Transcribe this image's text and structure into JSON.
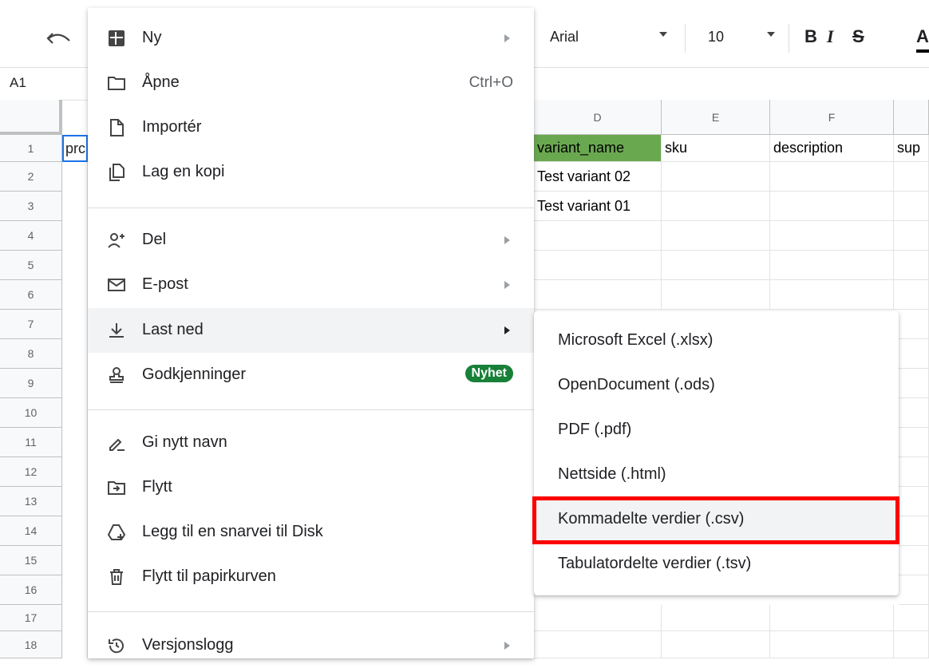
{
  "toolbar": {
    "font_name": "Arial",
    "font_size": "10",
    "bold_label": "B",
    "italic_label": "I",
    "strike_label": "S",
    "text_color_label": "A"
  },
  "formula_bar": {
    "name_box": "A1"
  },
  "grid": {
    "columns": [
      "D",
      "E",
      "F"
    ],
    "rows": [
      "1",
      "2",
      "3",
      "4",
      "5",
      "6",
      "7",
      "8",
      "9",
      "10",
      "11",
      "12",
      "13",
      "14",
      "15",
      "16",
      "17",
      "18"
    ],
    "a1_partial": "prc",
    "row1": [
      "variant_name",
      "sku",
      "description",
      "sup"
    ],
    "row2_d": "Test variant 02",
    "row3_d": "Test variant 01",
    "header_fill_color": "#6aa84f"
  },
  "file_menu": {
    "items": [
      {
        "label": "Ny",
        "icon": "new-sheet-icon",
        "submenu": true
      },
      {
        "label": "Åpne",
        "icon": "folder-icon",
        "shortcut": "Ctrl+O"
      },
      {
        "label": "Importér",
        "icon": "file-icon"
      },
      {
        "label": "Lag en kopi",
        "icon": "copy-icon"
      },
      {
        "label": "Del",
        "icon": "share-person-icon",
        "submenu": true
      },
      {
        "label": "E-post",
        "icon": "mail-icon",
        "submenu": true
      },
      {
        "label": "Last ned",
        "icon": "download-icon",
        "submenu": true
      },
      {
        "label": "Godkjenninger",
        "icon": "stamp-icon",
        "badge": "Nyhet"
      },
      {
        "label": "Gi nytt navn",
        "icon": "rename-pen-icon"
      },
      {
        "label": "Flytt",
        "icon": "move-folder-icon"
      },
      {
        "label": "Legg til en snarvei til Disk",
        "icon": "drive-shortcut-icon"
      },
      {
        "label": "Flytt til papirkurven",
        "icon": "trash-icon"
      },
      {
        "label": "Versjonslogg",
        "icon": "history-icon",
        "submenu": true
      }
    ],
    "badge_color": "#188038"
  },
  "download_submenu": {
    "items": [
      {
        "label": "Microsoft Excel (.xlsx)"
      },
      {
        "label": "OpenDocument (.ods)"
      },
      {
        "label": "PDF (.pdf)"
      },
      {
        "label": "Nettside (.html)"
      },
      {
        "label": "Kommadelte verdier (.csv)"
      },
      {
        "label": "Tabulatordelte verdier (.tsv)"
      }
    ],
    "highlight_color": "#ff0000"
  }
}
